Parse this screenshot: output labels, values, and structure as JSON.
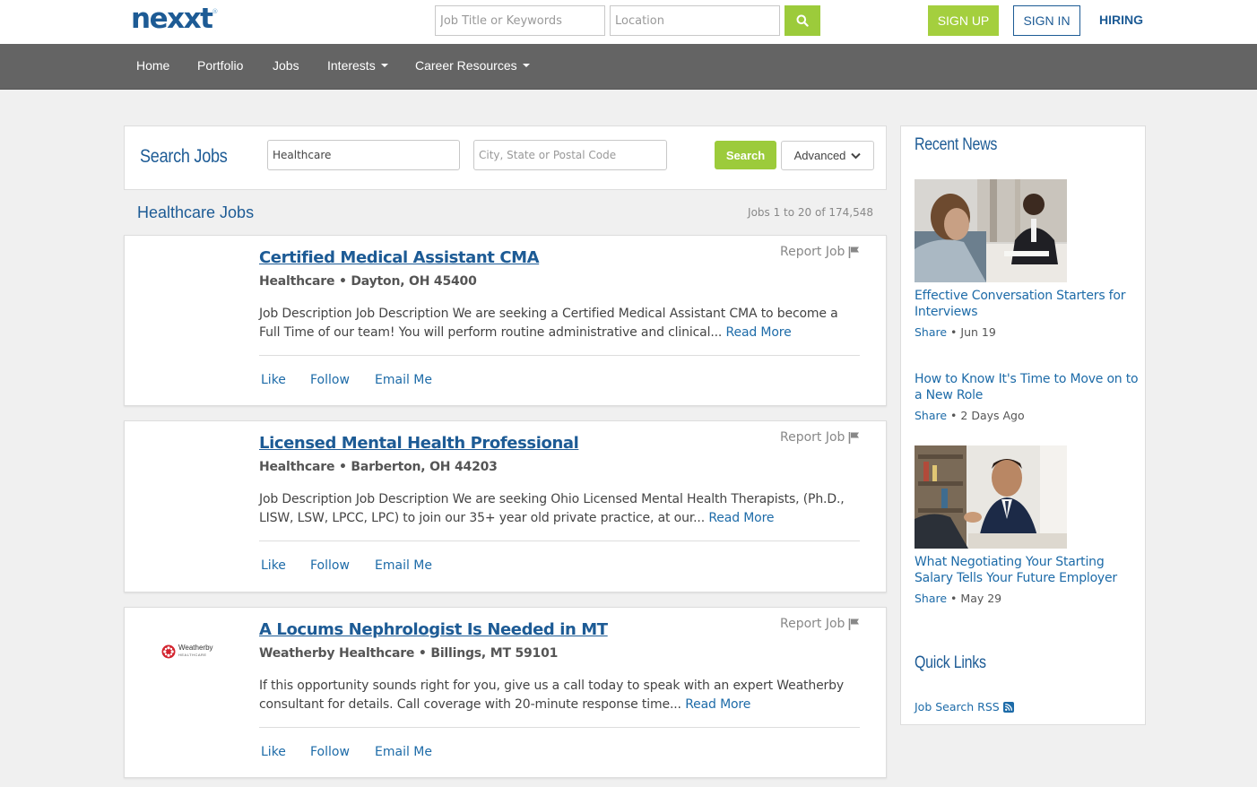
{
  "header": {
    "logo": "nexxt",
    "logo_mark": "®",
    "keyword_placeholder": "Job Title or Keywords",
    "location_placeholder": "Location",
    "search_icon": "search-icon",
    "signup_label": "SIGN UP",
    "signin_label": "SIGN IN",
    "hiring_label": "HIRING"
  },
  "nav": {
    "items": [
      "Home",
      "Portfolio",
      "Jobs",
      "Interests",
      "Career Resources"
    ]
  },
  "search_panel": {
    "title": "Search Jobs",
    "keyword_value": "Healthcare",
    "location_placeholder": "City, State or Postal Code",
    "search_label": "Search",
    "advanced_label": "Advanced"
  },
  "results": {
    "title": "Healthcare Jobs",
    "count": "Jobs 1 to 20 of 174,548"
  },
  "jobs": [
    {
      "title": "Certified Medical Assistant CMA",
      "company": "Healthcare",
      "location": "Dayton, OH 45400",
      "description": "Job Description Job Description We are seeking a Certified Medical Assistant CMA to become a Full Time of our team! You will perform routine administrative and clinical...",
      "read_more": "Read More",
      "report": "Report Job",
      "actions": [
        "Like",
        "Follow",
        "Email Me"
      ]
    },
    {
      "title": "Licensed Mental Health Professional",
      "company": "Healthcare",
      "location": "Barberton, OH 44203",
      "description": "Job Description Job Description We are seeking Ohio Licensed Mental Health Therapists, (Ph.D., LISW, LSW, LPCC, LPC) to join our 35+ year old private practice, at our...",
      "read_more": "Read More",
      "report": "Report Job",
      "actions": [
        "Like",
        "Follow",
        "Email Me"
      ]
    },
    {
      "title": "A Locums Nephrologist Is Needed in MT",
      "company": "Weatherby Healthcare",
      "location": "Billings, MT 59101",
      "logo_name": "Weatherby",
      "logo_sub": "HEALTHCARE",
      "description": "If this opportunity sounds right for you, give us a call today to speak with an expert Weatherby consultant for details. Call coverage with 20-minute response time...",
      "read_more": "Read More",
      "report": "Report Job",
      "actions": [
        "Like",
        "Follow",
        "Email Me"
      ]
    }
  ],
  "sidebar": {
    "recent_news_title": "Recent News",
    "news": [
      {
        "title": "Effective Conversation Starters for Interviews",
        "share": "Share",
        "date": "Jun 19"
      },
      {
        "title": "How to Know It's Time to Move on to a New Role",
        "share": "Share",
        "date": "2 Days Ago"
      },
      {
        "title": "What Negotiating Your Starting Salary Tells Your Future Employer",
        "share": "Share",
        "date": "May 29"
      }
    ],
    "quick_links_title": "Quick Links",
    "rss_label": "Job Search RSS"
  },
  "colors": {
    "brand_blue": "#1d5b95",
    "link_blue": "#1d6ba8",
    "accent_green": "#9ccb3b",
    "nav_gray": "#646464"
  }
}
